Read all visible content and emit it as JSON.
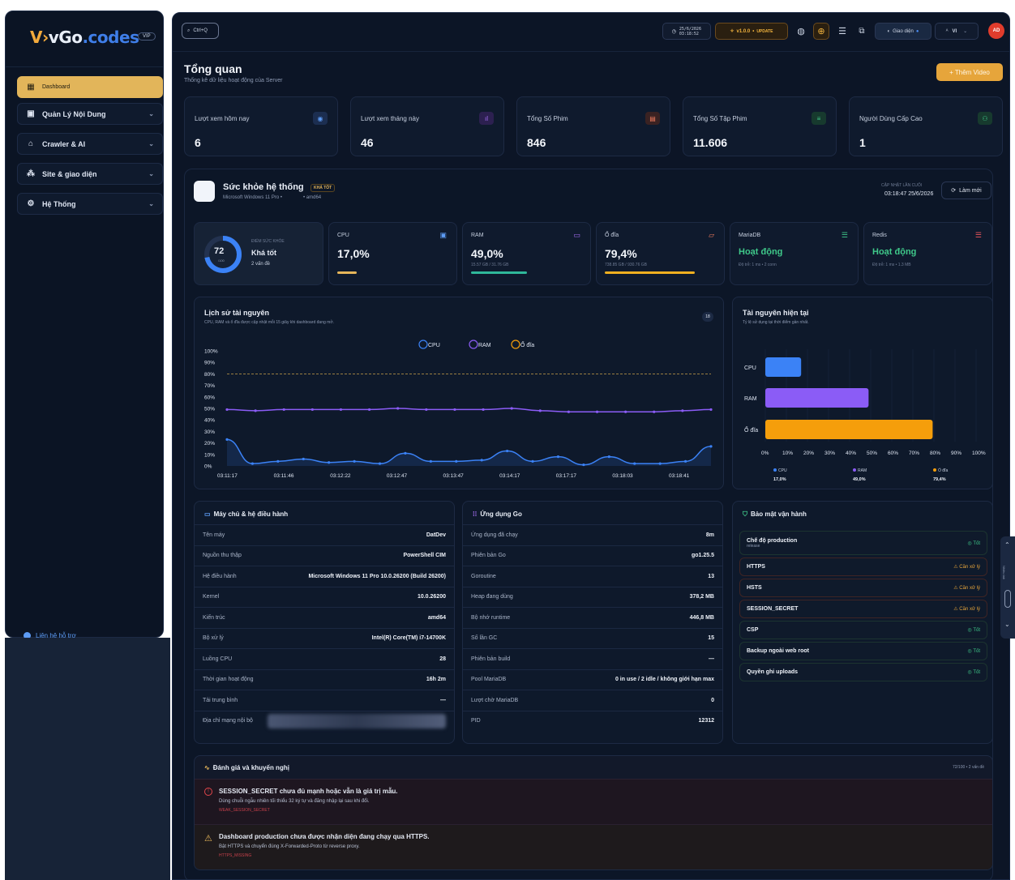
{
  "brand": {
    "part1": "V",
    "part2": "vGo",
    "part3": ".codes",
    "badge": "VIP"
  },
  "sidebar": {
    "items": [
      {
        "label": "Dashboard",
        "icon": "grid-icon"
      },
      {
        "label": "Quản Lý Nội Dung",
        "icon": "film-icon"
      },
      {
        "label": "Crawler & AI",
        "icon": "robot-icon"
      },
      {
        "label": "Site & giao diện",
        "icon": "shapes-icon"
      },
      {
        "label": "Hệ Thống",
        "icon": "gear-icon"
      }
    ],
    "support": "Liên hệ hỗ trợ"
  },
  "topbar": {
    "search_shortcut": "Ctrl+Q",
    "date": "25/6/2026",
    "time": "03:18:52",
    "version": "v1.0.0",
    "update": "UPDATE",
    "theme": "Giao diện",
    "lang": "VI",
    "avatar": "AD"
  },
  "page": {
    "title": "Tổng quan",
    "subtitle": "Thống kê dữ liệu hoạt động của Server",
    "add_video": "+ Thêm Video"
  },
  "stats": [
    {
      "label": "Lượt xem hôm nay",
      "value": "6",
      "color": "#5d9cf5"
    },
    {
      "label": "Lượt xem tháng này",
      "value": "46",
      "color": "#a66ef5"
    },
    {
      "label": "Tổng Số Phim",
      "value": "846",
      "color": "#f07b5d"
    },
    {
      "label": "Tổng Số Tập Phim",
      "value": "11.606",
      "color": "#3fc98a"
    },
    {
      "label": "Người Dùng Cấp Cao",
      "value": "1",
      "color": "#3fc98a"
    }
  ],
  "health": {
    "title": "Sức khỏe hệ thống",
    "badge": "KHÁ TỐT",
    "os": "Microsoft Windows 11 Pro •",
    "arch": "• amd64",
    "updated_label": "CẬP NHẬT LẦN CUỐI",
    "updated": "03:18:47 25/6/2026",
    "refresh": "Làm mới",
    "score": "72",
    "score_max": "/100",
    "score_label": "ĐIỂM SỨC KHỎE",
    "score_text": "Khá tốt",
    "issues": "2 vấn đề",
    "score_fraction": 0.72
  },
  "cards": [
    {
      "title": "CPU",
      "value": "17,0%",
      "sub": "",
      "pct": 17.0,
      "color": "#e6b65a"
    },
    {
      "title": "RAM",
      "value": "49,0%",
      "sub": "15.57 GB / 31.76 GB",
      "pct": 49.0,
      "color": "#2fb89a"
    },
    {
      "title": "Ổ đĩa",
      "value": "79,4%",
      "sub": "738.85 GB / 930.76 GB",
      "pct": 79.4,
      "color": "#f0b020"
    },
    {
      "title": "MariaDB",
      "value": "Hoạt động",
      "sub": "Độ trễ: 1 ms • 2 conn"
    },
    {
      "title": "Redis",
      "value": "Hoạt động",
      "sub": "Độ trễ: 1 ms • 1.3 MB"
    }
  ],
  "chart_data": [
    {
      "type": "line",
      "title": "Lịch sử tài nguyên",
      "subtitle": "CPU, RAM và ổ đĩa được cập nhật mỗi 15 giây khi dashboard đang mở.",
      "badge": "18",
      "x": [
        "03:11:17",
        "03:11:46",
        "03:12:22",
        "03:12:47",
        "03:13:47",
        "03:14:17",
        "03:17:17",
        "03:18:03",
        "03:18:41"
      ],
      "ylim": [
        0,
        100
      ],
      "yticks": [
        "0%",
        "10%",
        "20%",
        "30%",
        "40%",
        "50%",
        "60%",
        "70%",
        "80%",
        "90%",
        "100%"
      ],
      "threshold": 80,
      "series": [
        {
          "name": "CPU",
          "color": "#3b82f6",
          "values": [
            23,
            2,
            4,
            6,
            3,
            4,
            2,
            11,
            4,
            4,
            5,
            13,
            4,
            8,
            1,
            8,
            2,
            2,
            4,
            17
          ]
        },
        {
          "name": "RAM",
          "color": "#8b5cf6",
          "values": [
            49,
            48,
            49,
            49,
            49,
            49,
            50,
            49,
            49,
            49,
            50,
            48,
            47,
            47,
            47,
            47,
            48,
            49
          ]
        },
        {
          "name": "Ổ đĩa",
          "color": "#f59e0b",
          "values": []
        }
      ]
    },
    {
      "type": "bar",
      "title": "Tài nguyên hiện tại",
      "subtitle": "Tỷ lệ sử dụng tại thời điểm gần nhất.",
      "categories": [
        "CPU",
        "RAM",
        "Ổ đĩa"
      ],
      "values": [
        17.0,
        49.0,
        79.4
      ],
      "colors": [
        "#3b82f6",
        "#8b5cf6",
        "#f59e0b"
      ],
      "xticks": [
        "0%",
        "10%",
        "20%",
        "30%",
        "40%",
        "50%",
        "60%",
        "70%",
        "80%",
        "90%",
        "100%"
      ],
      "xlim": [
        0,
        100
      ],
      "legend": [
        {
          "name": "CPU",
          "value": "17,0%"
        },
        {
          "name": "RAM",
          "value": "49,0%"
        },
        {
          "name": "Ổ đĩa",
          "value": "79,4%"
        }
      ]
    }
  ],
  "server": {
    "title": "Máy chủ & hệ điều hành",
    "rows": [
      [
        "Tên máy",
        "DatDev"
      ],
      [
        "Nguồn thu thập",
        "PowerShell CIM"
      ],
      [
        "Hệ điều hành",
        "Microsoft Windows 11 Pro 10.0.26200 (Build 26200)"
      ],
      [
        "Kernel",
        "10.0.26200"
      ],
      [
        "Kiến trúc",
        "amd64"
      ],
      [
        "Bộ xử lý",
        "Intel(R) Core(TM) i7-14700K"
      ],
      [
        "Luồng CPU",
        "28"
      ],
      [
        "Thời gian hoạt động",
        "16h 2m"
      ],
      [
        "Tải trung bình",
        "—"
      ],
      [
        "Địa chỉ mạng nội bộ",
        ""
      ]
    ]
  },
  "goapp": {
    "title": "Ứng dụng Go",
    "rows": [
      [
        "Ứng dụng đã chạy",
        "8m"
      ],
      [
        "Phiên bản Go",
        "go1.25.5"
      ],
      [
        "Goroutine",
        "13"
      ],
      [
        "Heap đang dùng",
        "378,2 MB"
      ],
      [
        "Bộ nhớ runtime",
        "446,8 MB"
      ],
      [
        "Số lần GC",
        "15"
      ],
      [
        "Phiên bản build",
        "—"
      ],
      [
        "Pool MariaDB",
        "0 in use / 2 idle / không giới hạn max"
      ],
      [
        "Lượt chờ MariaDB",
        "0"
      ],
      [
        "PID",
        "12312"
      ]
    ]
  },
  "security": {
    "title": "Bảo mật vận hành",
    "items": [
      {
        "label": "Chế độ production",
        "sub": "release",
        "status": "Tốt",
        "warn": false
      },
      {
        "label": "HTTPS",
        "status": "Cần xử lý",
        "warn": true
      },
      {
        "label": "HSTS",
        "status": "Cần xử lý",
        "warn": true
      },
      {
        "label": "SESSION_SECRET",
        "status": "Cần xử lý",
        "warn": true
      },
      {
        "label": "CSP",
        "status": "Tốt",
        "warn": false
      },
      {
        "label": "Backup ngoài web root",
        "status": "Tốt",
        "warn": false
      },
      {
        "label": "Quyền ghi uploads",
        "status": "Tốt",
        "warn": false
      }
    ]
  },
  "recommend": {
    "title": "Đánh giá và khuyến nghị",
    "summary": "72/100 • 2 vấn đề",
    "items": [
      {
        "title": "SESSION_SECRET chưa đủ mạnh hoặc vẫn là giá trị mẫu.",
        "desc": "Dùng chuỗi ngẫu nhiên tối thiểu 32 ký tự và đăng nhập lại sau khi đổi.",
        "code": "WEAK_SESSION_SECRET"
      },
      {
        "title": "Dashboard production chưa được nhận diện đang chạy qua HTTPS.",
        "desc": "Bật HTTPS và chuyển đúng X-Forwarded-Proto từ reverse proxy.",
        "code": "HTTPS_MISSING"
      }
    ]
  },
  "side_widget": {
    "label": "Nhiều tab"
  }
}
